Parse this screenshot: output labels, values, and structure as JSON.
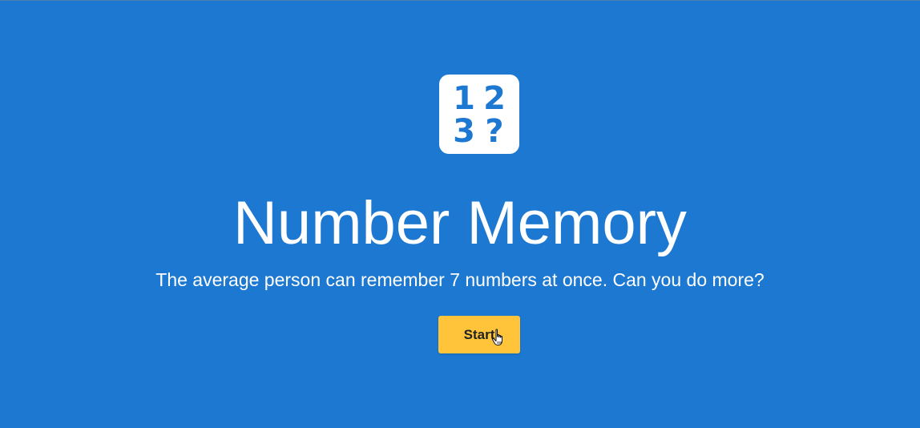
{
  "app": {
    "title": "Number Memory",
    "subtitle": "The average person can remember 7 numbers at once. Can you do more?"
  },
  "logo": {
    "glyphs": [
      "1",
      "2",
      "3",
      "?"
    ],
    "icon": "number-memory-icon"
  },
  "actions": {
    "start_label": "Start"
  },
  "colors": {
    "background": "#1c78d0",
    "button": "#ffc43a",
    "text": "#ffffff"
  }
}
